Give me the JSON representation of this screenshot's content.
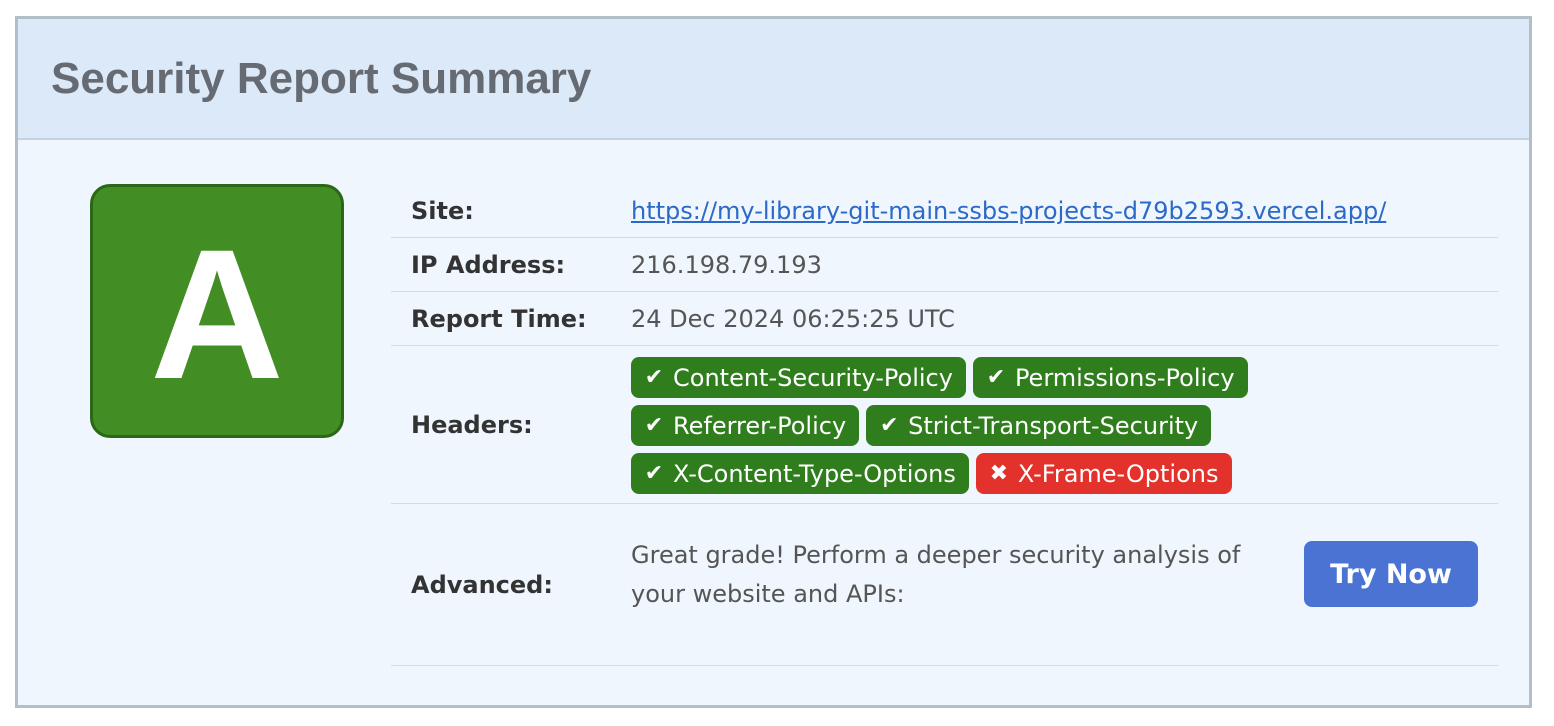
{
  "header": {
    "title": "Security Report Summary"
  },
  "grade": {
    "letter": "A",
    "color": "#438d25"
  },
  "rows": {
    "site": {
      "label": "Site:",
      "value": "https://my-library-git-main-ssbs-projects-d79b2593.vercel.app/"
    },
    "ip": {
      "label": "IP Address:",
      "value": "216.198.79.193"
    },
    "time": {
      "label": "Report Time:",
      "value": "24 Dec 2024 06:25:25 UTC"
    },
    "headers": {
      "label": "Headers:"
    },
    "advanced": {
      "label": "Advanced:",
      "text": "Great grade! Perform a deeper security analysis of your website and APIs:",
      "button": "Try Now"
    }
  },
  "headers": [
    {
      "name": "Content-Security-Policy",
      "status": "pass",
      "icon": "check-icon"
    },
    {
      "name": "Permissions-Policy",
      "status": "pass",
      "icon": "check-icon"
    },
    {
      "name": "Referrer-Policy",
      "status": "pass",
      "icon": "check-icon"
    },
    {
      "name": "Strict-Transport-Security",
      "status": "pass",
      "icon": "check-icon"
    },
    {
      "name": "X-Content-Type-Options",
      "status": "pass",
      "icon": "check-icon"
    },
    {
      "name": "X-Frame-Options",
      "status": "fail",
      "icon": "cross-icon"
    }
  ],
  "colors": {
    "pass": "#2f7d1c",
    "fail": "#e3322b",
    "button": "#4b73d3",
    "link": "#2c69c8"
  }
}
